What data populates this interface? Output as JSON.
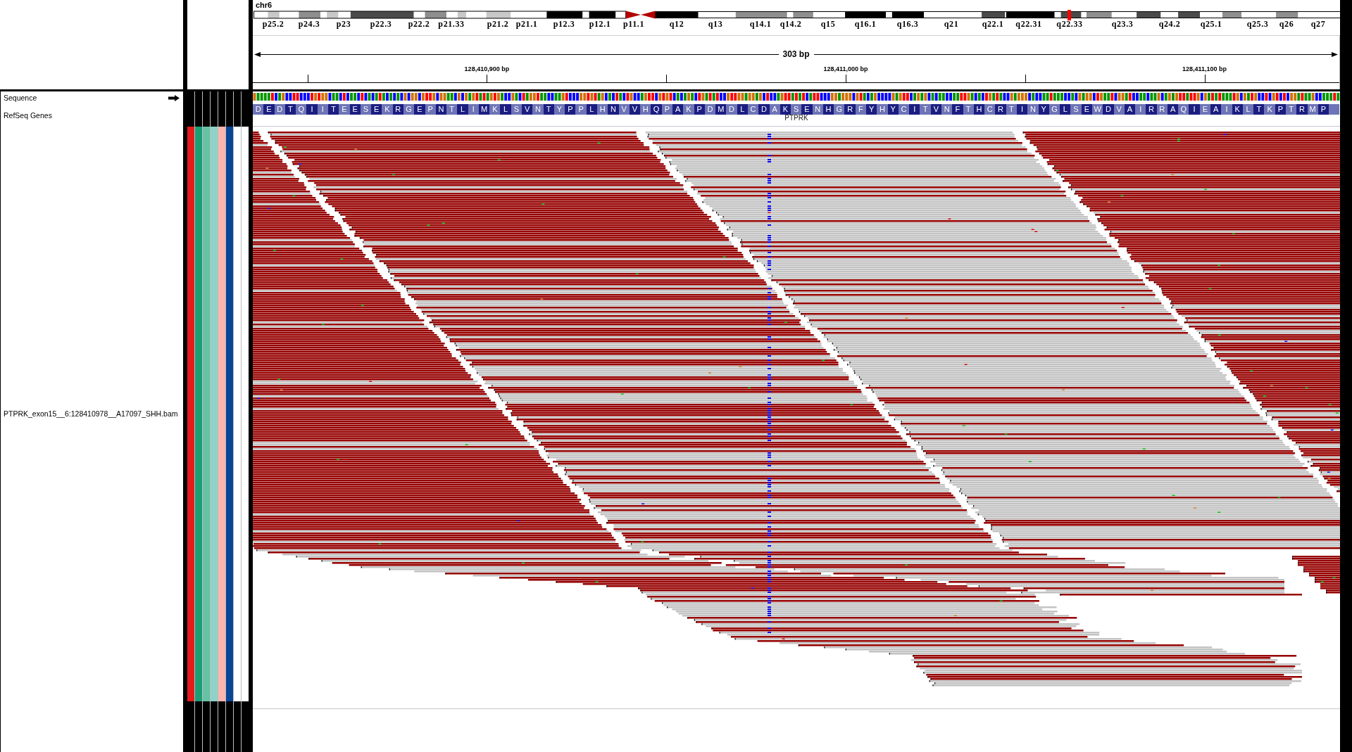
{
  "ideogram": {
    "chromosome": "chr6",
    "band_labels": [
      "p25.2",
      "p24.3",
      "p23",
      "p22.3",
      "p22.2",
      "p21.33",
      "p21.2",
      "p21.1",
      "p12.3",
      "p12.1",
      "p11.1",
      "q12",
      "q13",
      "q14.1",
      "q14.2",
      "q15",
      "q16.1",
      "q16.3",
      "q21",
      "q22.1",
      "q22.31",
      "q22.33",
      "q23.3",
      "q24.2",
      "q25.1",
      "q25.3",
      "q26",
      "q27"
    ]
  },
  "ruler": {
    "span": "303 bp",
    "tick_labels": [
      "128,410,900 bp",
      "128,411,000 bp",
      "128,411,100 bp"
    ]
  },
  "tracks": [
    {
      "kind": "sequence",
      "name": "Sequence"
    },
    {
      "kind": "genes",
      "name": "RefSeq Genes",
      "gene": "PTPRK",
      "amino_acids": [
        "D",
        "E",
        "D",
        "T",
        "Q",
        "I",
        "I",
        "T",
        "E",
        "E",
        "S",
        "E",
        "K",
        "R",
        "G",
        "E",
        "P",
        "N",
        "T",
        "L",
        "I",
        "M",
        "K",
        "L",
        "S",
        "V",
        "N",
        "T",
        "Y",
        "P",
        "P",
        "L",
        "H",
        "N",
        "V",
        "V",
        "H",
        "Q",
        "P",
        "A",
        "K",
        "P",
        "D",
        "M",
        "D",
        "L",
        "C",
        "D",
        "A",
        "K",
        "S",
        "E",
        "N",
        "H",
        "G",
        "R",
        "F",
        "Y",
        "H",
        "Y",
        "C",
        "I",
        "T",
        "V",
        "N",
        "F",
        "T",
        "H",
        "C",
        "R",
        "T",
        "I",
        "N",
        "Y",
        "G",
        "L",
        "S",
        "E",
        "W",
        "D",
        "V",
        "A",
        "I",
        "R",
        "R",
        "A",
        "Q",
        "I",
        "E",
        "A",
        "I",
        "K",
        "L",
        "T",
        "K",
        "P",
        "T",
        "R",
        "M",
        "P"
      ]
    },
    {
      "kind": "alignments",
      "name": "PTPRK_exon15__6:128410978__A17097_SHH.bam",
      "attributes": [
        {
          "color": "#e41a1c"
        },
        {
          "color": "#1b9e77"
        },
        {
          "color": "#66c2a5"
        },
        {
          "color": "#8dd3c7"
        },
        {
          "color": "#fbb4ae"
        },
        {
          "color": "#084594"
        },
        {
          "color": "#ffffff"
        },
        {
          "color": "#ffffff"
        }
      ]
    }
  ]
}
